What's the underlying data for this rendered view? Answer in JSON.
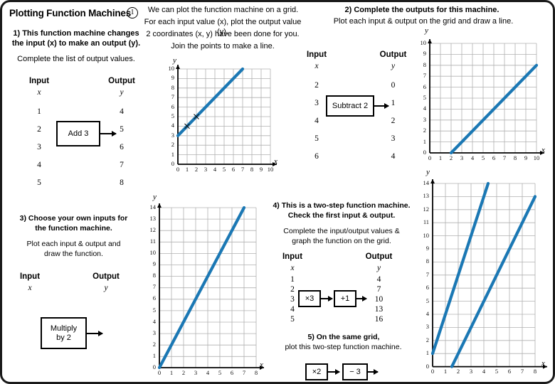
{
  "page": {
    "title": "Plotting Function Machines",
    "number_badge": "1"
  },
  "q1": {
    "line1": "1) This function machine changes",
    "line2": "the input (x) to make an output (y).",
    "line3": "Complete the list of output values.",
    "table": {
      "input_header": "Input",
      "input_var": "x",
      "output_header": "Output",
      "output_var": "y",
      "inputs": [
        "1",
        "2",
        "3",
        "4",
        "5"
      ],
      "outputs": [
        "4",
        "5",
        "6",
        "7",
        "8"
      ]
    },
    "machine": "Add 3"
  },
  "intro": {
    "line1": "We can plot the function machine on a grid.",
    "line2": "For each input value (x), plot the output value (y).",
    "line3": "2 coordinates (x, y) have been done for you.",
    "line4": "Join the points to make a line."
  },
  "q2": {
    "line1": "2) Complete the outputs for this machine.",
    "line2": "Plot each input & output on the grid and draw a line.",
    "table": {
      "input_header": "Input",
      "input_var": "x",
      "output_header": "Output",
      "output_var": "y",
      "inputs": [
        "2",
        "3",
        "4",
        "5",
        "6"
      ],
      "outputs": [
        "0",
        "1",
        "2",
        "3",
        "4"
      ]
    },
    "machine": "Subtract 2"
  },
  "q3": {
    "line1": "3) Choose your own inputs for",
    "line2": "the function machine.",
    "line3": "Plot each input & output and",
    "line4": "draw the function.",
    "table": {
      "input_header": "Input",
      "input_var": "x",
      "output_header": "Output",
      "output_var": "y",
      "inputs": [
        "",
        "",
        "",
        "",
        ""
      ],
      "outputs": [
        "",
        "",
        "",
        "",
        ""
      ]
    },
    "machine_line1": "Multiply",
    "machine_line2": "by  2"
  },
  "q4": {
    "line1": "4) This is a two-step function machine.",
    "line2": "Check the first input & output.",
    "line3": "Complete the input/output values &",
    "line4": "graph the function on the grid.",
    "table": {
      "input_header": "Input",
      "input_var": "x",
      "output_header": "Output",
      "output_var": "y",
      "inputs": [
        "1",
        "2",
        "3",
        "4",
        "5"
      ],
      "outputs": [
        "4",
        "7",
        "10",
        "13",
        "16"
      ]
    },
    "machine_a": "×3",
    "machine_b": "+1"
  },
  "q5": {
    "line1": "5) On the same grid,",
    "line2": "plot this two-step function machine.",
    "machine_a": "×2",
    "machine_b": "− 3"
  },
  "colors": {
    "line": "#1b78b4",
    "grid": "#b0b0b0",
    "axis": "#000000",
    "border": "#1a1a1a"
  },
  "chart_data": [
    {
      "id": "grid1",
      "type": "line",
      "title": "",
      "xlabel": "x",
      "ylabel": "y",
      "xlim": [
        0,
        10
      ],
      "ylim": [
        0,
        10
      ],
      "grid": true,
      "xticks": [
        "0",
        "1",
        "2",
        "3",
        "4",
        "5",
        "6",
        "7",
        "8",
        "9",
        "10"
      ],
      "yticks": [
        "0",
        "1",
        "2",
        "3",
        "4",
        "5",
        "6",
        "7",
        "8",
        "9",
        "10"
      ],
      "series": [
        {
          "name": "y = x + 3",
          "points": [
            [
              0,
              3
            ],
            [
              7,
              10
            ]
          ]
        }
      ],
      "markers": [
        [
          1,
          4
        ],
        [
          2,
          5
        ]
      ],
      "marker_style": "x"
    },
    {
      "id": "grid2",
      "type": "line",
      "title": "",
      "xlabel": "x",
      "ylabel": "y",
      "xlim": [
        0,
        10
      ],
      "ylim": [
        0,
        10
      ],
      "grid": true,
      "xticks": [
        "0",
        "1",
        "2",
        "3",
        "4",
        "5",
        "6",
        "7",
        "8",
        "9",
        "10"
      ],
      "yticks": [
        "0",
        "1",
        "2",
        "3",
        "4",
        "5",
        "6",
        "7",
        "8",
        "9",
        "10"
      ],
      "series": [
        {
          "name": "y = x - 2",
          "points": [
            [
              2,
              0
            ],
            [
              10,
              8
            ]
          ]
        }
      ],
      "markers": [],
      "marker_style": "none"
    },
    {
      "id": "grid3",
      "type": "line",
      "title": "",
      "xlabel": "x",
      "ylabel": "y",
      "xlim": [
        0,
        8
      ],
      "ylim": [
        0,
        14
      ],
      "grid": true,
      "xticks": [
        "0",
        "1",
        "2",
        "3",
        "4",
        "5",
        "6",
        "7",
        "8"
      ],
      "yticks": [
        "0",
        "1",
        "2",
        "3",
        "4",
        "5",
        "6",
        "7",
        "8",
        "9",
        "10",
        "11",
        "12",
        "13",
        "14"
      ],
      "series": [
        {
          "name": "y = 2x",
          "points": [
            [
              0,
              0
            ],
            [
              7,
              14
            ]
          ]
        }
      ],
      "markers": [],
      "marker_style": "none"
    },
    {
      "id": "grid4",
      "type": "line",
      "title": "",
      "xlabel": "x",
      "ylabel": "y",
      "xlim": [
        0,
        8
      ],
      "ylim": [
        0,
        14
      ],
      "grid": true,
      "xticks": [
        "0",
        "1",
        "2",
        "3",
        "4",
        "5",
        "6",
        "7",
        "8"
      ],
      "yticks": [
        "0",
        "1",
        "2",
        "3",
        "4",
        "5",
        "6",
        "7",
        "8",
        "9",
        "10",
        "11",
        "12",
        "13",
        "14"
      ],
      "series": [
        {
          "name": "y = 3x + 1",
          "points": [
            [
              0,
              1
            ],
            [
              4.33,
              14
            ]
          ]
        },
        {
          "name": "y = 2x - 3",
          "points": [
            [
              1.5,
              0
            ],
            [
              8,
              13
            ]
          ]
        }
      ],
      "markers": [],
      "marker_style": "none"
    }
  ]
}
